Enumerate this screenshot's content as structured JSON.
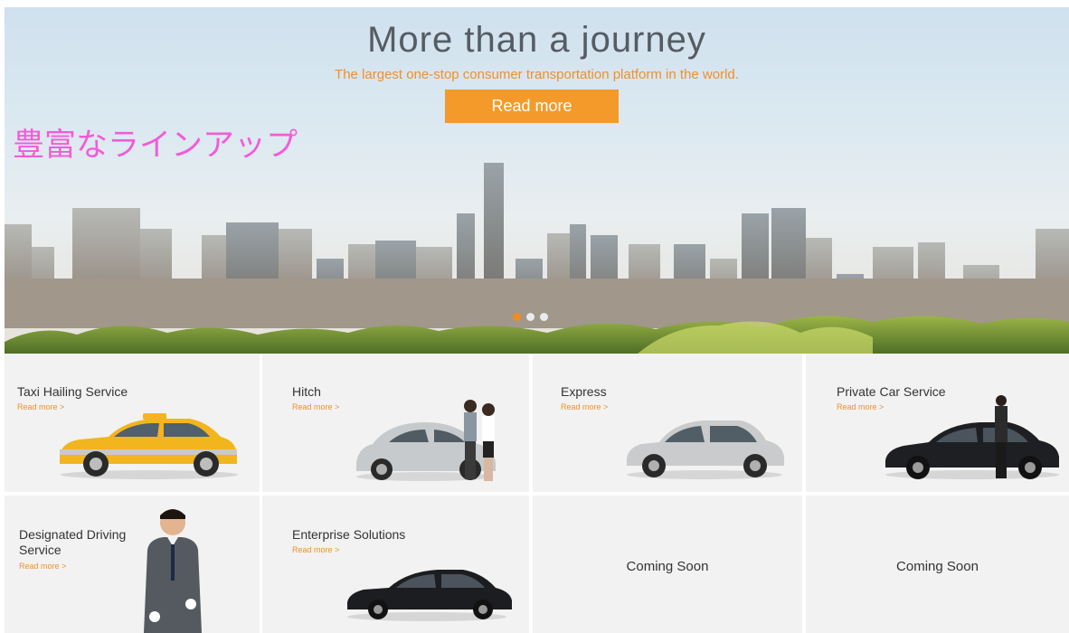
{
  "hero": {
    "title": "More than a journey",
    "subtitle": "The largest one-stop consumer transportation platform in the world.",
    "button_label": "Read more",
    "overlay_text": "豊富なラインアップ",
    "slides": 3,
    "active_slide": 0
  },
  "colors": {
    "accent": "#f49a2a",
    "overlay": "#f25cd9",
    "tile_bg": "#f2f2f2"
  },
  "services": [
    {
      "title": "Taxi Hailing Service",
      "link": "Read more >",
      "image": "yellow-taxi"
    },
    {
      "title": "Hitch",
      "link": "Read more >",
      "image": "silver-beetle-couple"
    },
    {
      "title": "Express",
      "link": "Read more >",
      "image": "silver-hatchback"
    },
    {
      "title": "Private Car Service",
      "link": "Read more >",
      "image": "black-sedan-chauffeur"
    },
    {
      "title": "Designated Driving Service",
      "link": "Read more >",
      "image": "driver-in-suit"
    },
    {
      "title": "Enterprise Solutions",
      "link": "Read more >",
      "image": "black-luxury-sedan"
    },
    {
      "title": "Coming Soon"
    },
    {
      "title": "Coming Soon"
    }
  ]
}
